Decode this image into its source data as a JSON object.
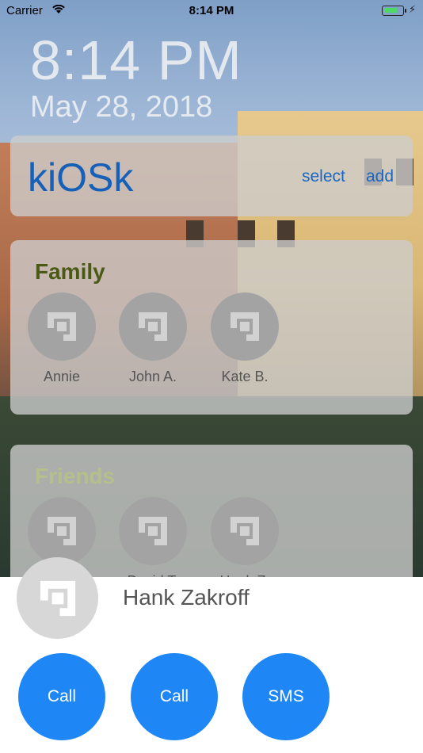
{
  "status_bar": {
    "carrier": "Carrier",
    "time": "8:14 PM",
    "battery_color": "#4cd964"
  },
  "lock": {
    "time": "8:14 PM",
    "date": "May 28, 2018"
  },
  "header": {
    "app_title": "kiOSk",
    "select_label": "select",
    "add_label": "add",
    "accent": "#1a66c5"
  },
  "groups": [
    {
      "title": "Family",
      "title_color": "#4a5a16",
      "contacts": [
        {
          "name": "Annie"
        },
        {
          "name": "John A."
        },
        {
          "name": "Kate B."
        }
      ]
    },
    {
      "title": "Friends",
      "title_color": "#b4c08c",
      "contacts": [
        {
          "name": ""
        },
        {
          "name": "David T."
        },
        {
          "name": "Hank Z."
        }
      ]
    }
  ],
  "sheet": {
    "contact_name": "Hank Zakroff",
    "actions": [
      {
        "label": "Call"
      },
      {
        "label": "Call"
      },
      {
        "label": "SMS"
      }
    ],
    "button_color": "#1f87f5"
  }
}
